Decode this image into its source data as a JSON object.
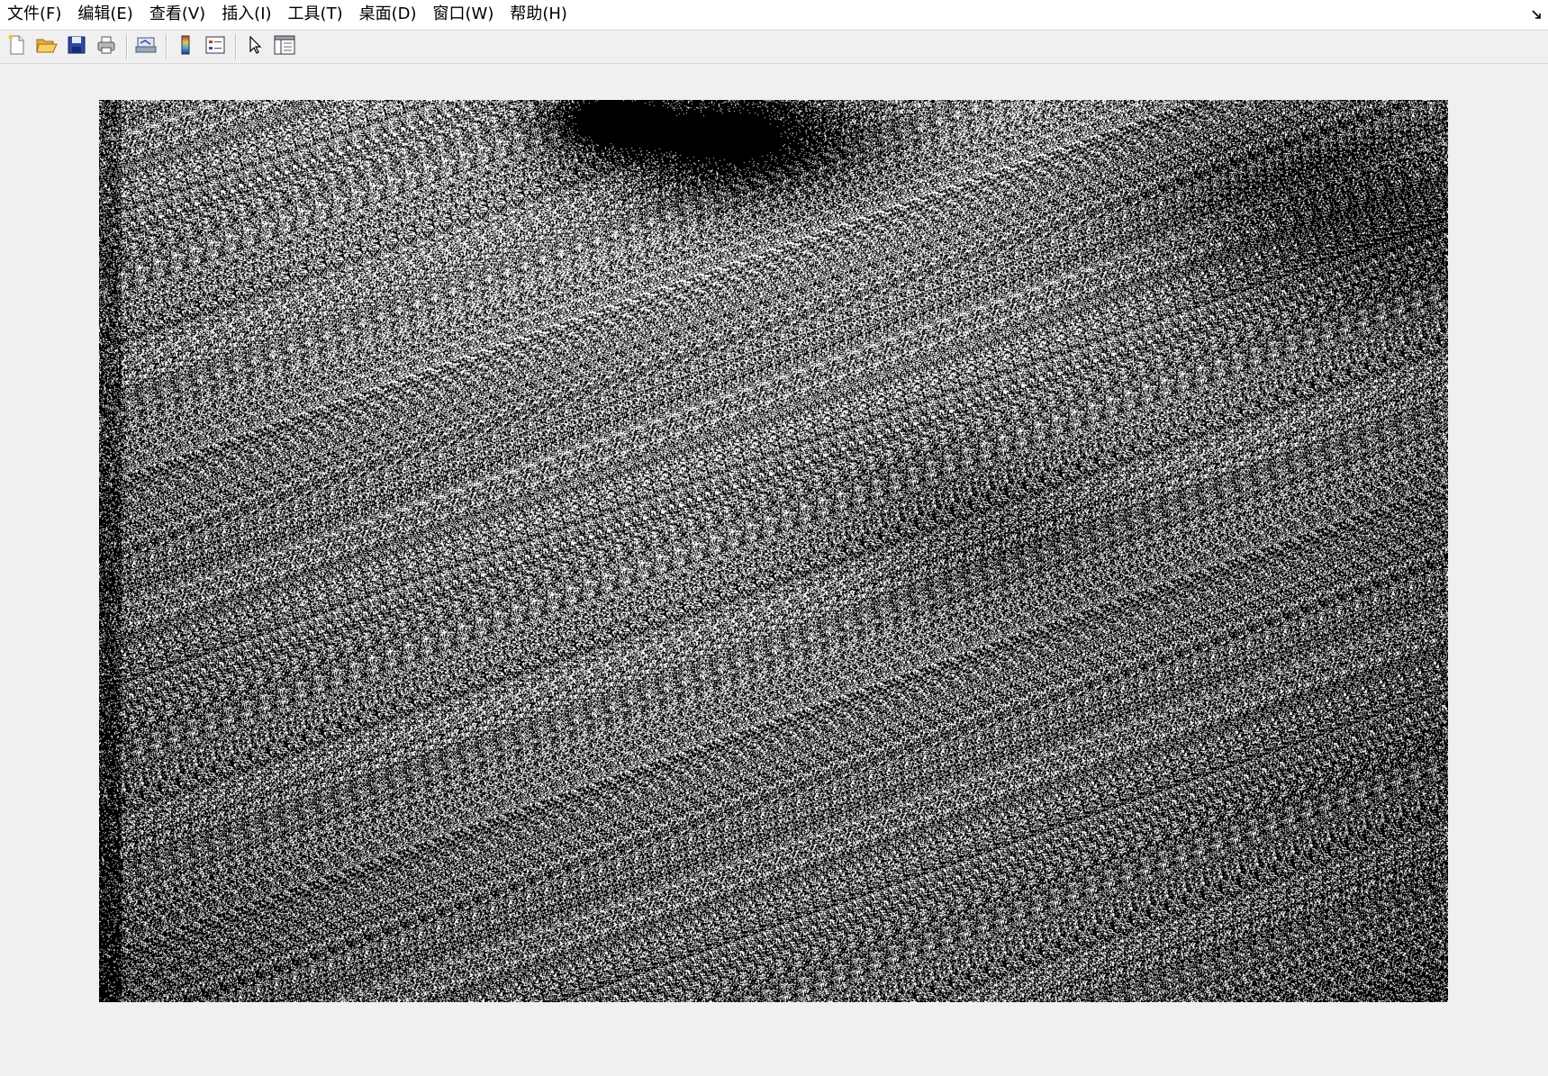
{
  "menubar": {
    "items": [
      {
        "label": "文件(F)"
      },
      {
        "label": "编辑(E)"
      },
      {
        "label": "查看(V)"
      },
      {
        "label": "插入(I)"
      },
      {
        "label": "工具(T)"
      },
      {
        "label": "桌面(D)"
      },
      {
        "label": "窗口(W)"
      },
      {
        "label": "帮助(H)"
      }
    ]
  },
  "toolbar": {
    "buttons": [
      {
        "icon": "new-figure-icon"
      },
      {
        "icon": "open-file-icon"
      },
      {
        "icon": "save-icon"
      },
      {
        "icon": "print-icon"
      },
      {
        "icon": "link-plot-icon"
      },
      {
        "icon": "insert-colorbar-icon"
      },
      {
        "icon": "insert-legend-icon"
      },
      {
        "icon": "edit-plot-icon"
      },
      {
        "icon": "property-inspector-icon"
      }
    ]
  },
  "figure": {
    "image_description_type": "binary noise image",
    "colors": {
      "dark": "#000000",
      "light": "#ffffff"
    }
  }
}
